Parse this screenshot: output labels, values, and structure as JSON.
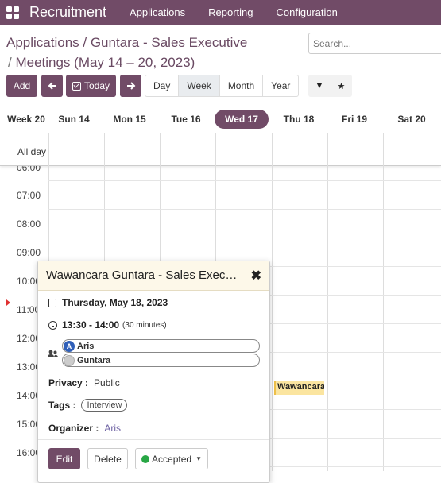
{
  "navbar": {
    "brand": "Recruitment",
    "menu": [
      "Applications",
      "Reporting",
      "Configuration"
    ]
  },
  "breadcrumb": {
    "line1": "Applications / Guntara - Sales Executive",
    "line2_sep": "/ ",
    "line2": "Meetings",
    "line2_range": "(May 14 – 20, 2023)"
  },
  "search": {
    "placeholder": "Search..."
  },
  "toolbar": {
    "add": "Add",
    "today": "Today",
    "scales": [
      "Day",
      "Week",
      "Month",
      "Year"
    ],
    "active_scale": "Week",
    "filter_icon": "▼",
    "favorite_icon": "★"
  },
  "calendar": {
    "week_label": "Week 20",
    "days": [
      "Sun 14",
      "Mon 15",
      "Tue 16",
      "Wed 17",
      "Thu 18",
      "Fri 19",
      "Sat 20"
    ],
    "active_day": "Wed 17",
    "allday_label": "All day",
    "hours": [
      "06:00",
      "07:00",
      "08:00",
      "09:00",
      "10:00",
      "11:00",
      "12:00",
      "13:00",
      "14:00",
      "15:00",
      "16:00"
    ],
    "event_label": "Wawancara"
  },
  "popover": {
    "title": "Wawancara Guntara - Sales Executive",
    "date": "Thursday, May 18, 2023",
    "time": "13:30 - 14:00",
    "duration": "(30 minutes)",
    "attendees": [
      {
        "initial": "A",
        "name": "Aris"
      },
      {
        "initial": "",
        "name": "Guntara"
      }
    ],
    "privacy_label": "Privacy :",
    "privacy_value": "Public",
    "tags_label": "Tags :",
    "tag": "Interview",
    "organizer_label": "Organizer :",
    "organizer_value": "Aris",
    "edit": "Edit",
    "delete": "Delete",
    "status": "Accepted"
  },
  "colors": {
    "brand": "#714b67",
    "now_line": "#e03030",
    "event_bg": "#fbe5a0",
    "accepted": "#28a745"
  }
}
